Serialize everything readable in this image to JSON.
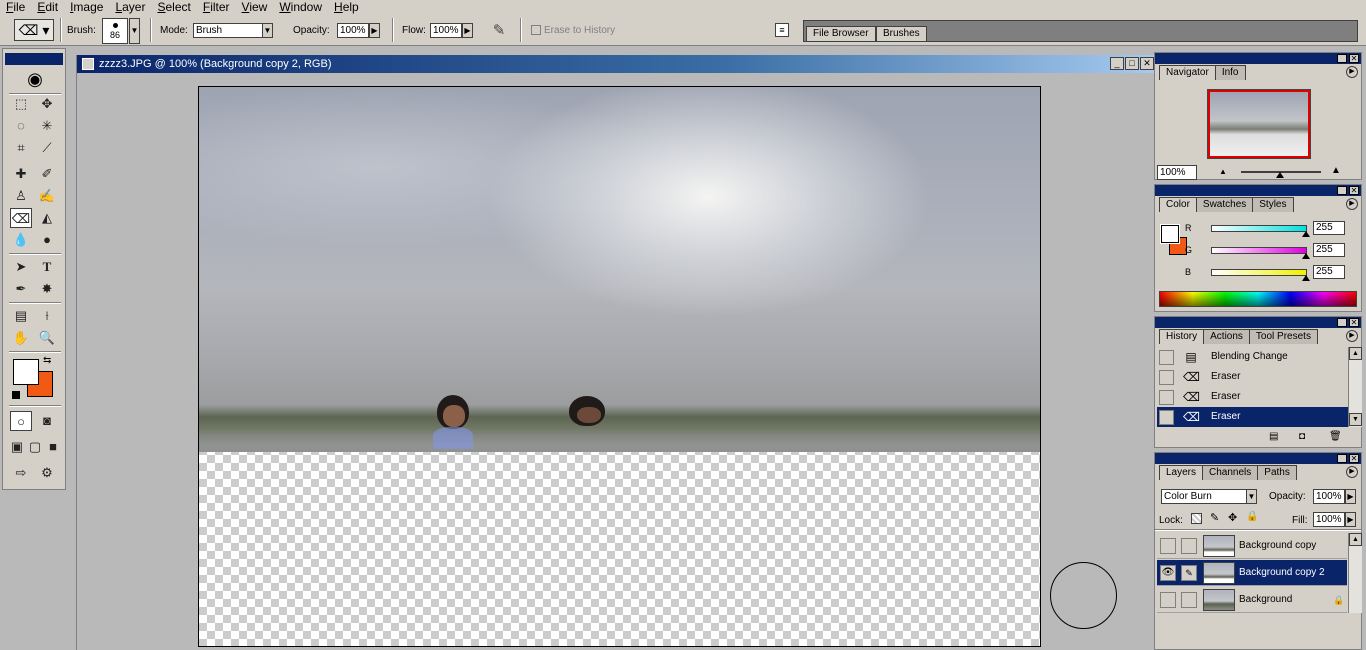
{
  "menu": [
    "File",
    "Edit",
    "Image",
    "Layer",
    "Select",
    "Filter",
    "View",
    "Window",
    "Help"
  ],
  "options": {
    "brush_label": "Brush:",
    "brush_size": "86",
    "mode_label": "Mode:",
    "mode_value": "Brush",
    "opacity_label": "Opacity:",
    "opacity_value": "100%",
    "flow_label": "Flow:",
    "flow_value": "100%",
    "erase_history_label": "Erase to History"
  },
  "palette_well": {
    "tabs": [
      "File Browser",
      "Brushes"
    ]
  },
  "document": {
    "title": "zzzz3.JPG @ 100% (Background copy 2, RGB)"
  },
  "navigator": {
    "tabs": [
      "Navigator",
      "Info"
    ],
    "zoom": "100%"
  },
  "color": {
    "tabs": [
      "Color",
      "Swatches",
      "Styles"
    ],
    "channels": [
      {
        "label": "R",
        "value": "255",
        "color": "#00e0e0"
      },
      {
        "label": "G",
        "value": "255",
        "color": "#e000e0"
      },
      {
        "label": "B",
        "value": "255",
        "color": "#f0f000"
      }
    ],
    "foreground": "#ffffff",
    "background": "#f05a14"
  },
  "history": {
    "tabs": [
      "History",
      "Actions",
      "Tool Presets"
    ],
    "items": [
      {
        "label": "Blending Change",
        "icon": "blending-change-icon"
      },
      {
        "label": "Eraser",
        "icon": "eraser-icon"
      },
      {
        "label": "Eraser",
        "icon": "eraser-icon"
      },
      {
        "label": "Eraser",
        "icon": "eraser-icon",
        "selected": true
      }
    ]
  },
  "layers": {
    "tabs": [
      "Layers",
      "Channels",
      "Paths"
    ],
    "blend_mode": "Color Burn",
    "opacity_label": "Opacity:",
    "opacity_value": "100%",
    "lock_label": "Lock:",
    "fill_label": "Fill:",
    "fill_value": "100%",
    "items": [
      {
        "name": "Background copy",
        "visible": false
      },
      {
        "name": "Background copy 2",
        "visible": true,
        "selected": true
      },
      {
        "name": "Background",
        "visible": false,
        "locked": true
      }
    ]
  }
}
